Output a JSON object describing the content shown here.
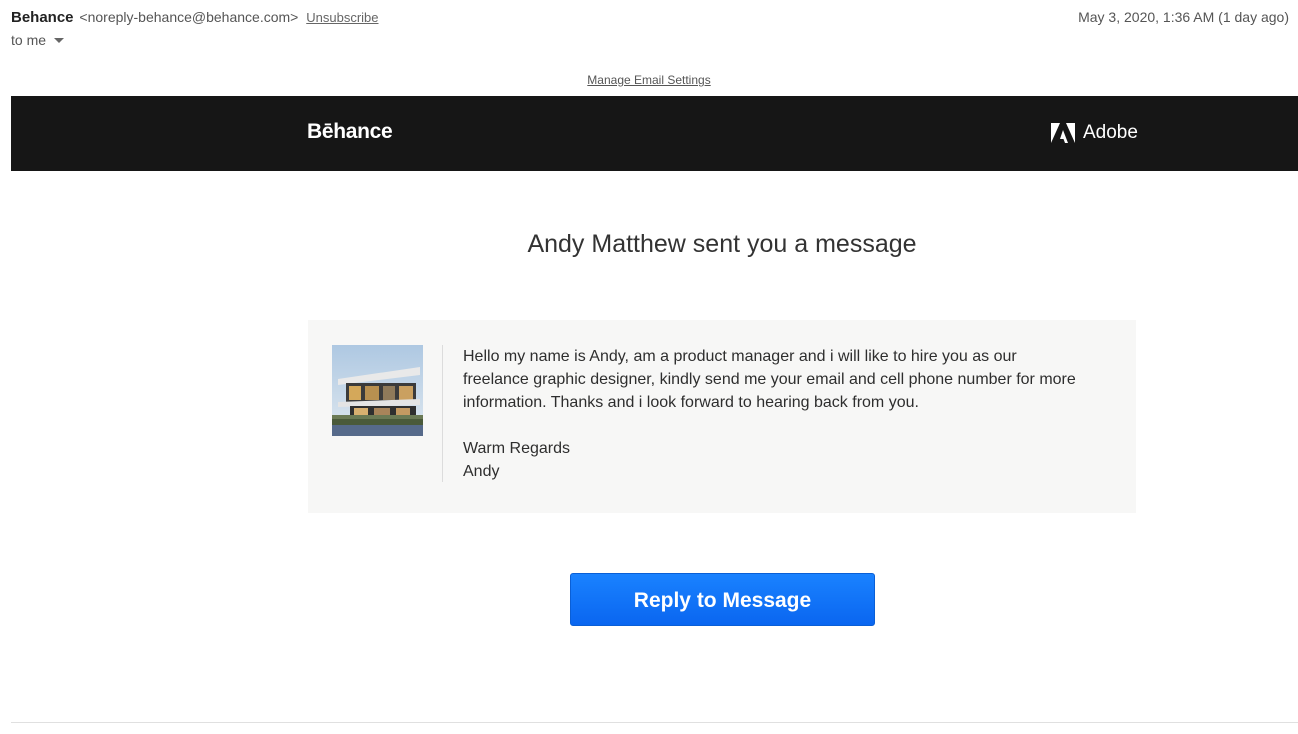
{
  "header": {
    "sender_name": "Behance",
    "sender_email": "<noreply-behance@behance.com>",
    "unsubscribe_label": "Unsubscribe",
    "date": "May 3, 2020, 1:36 AM (1 day ago)",
    "to_label": "to me"
  },
  "manage_settings_label": "Manage Email Settings",
  "brand_bar": {
    "behance_label": "Bēhance",
    "adobe_label": "Adobe"
  },
  "message": {
    "title": "Andy Matthew sent you a message",
    "paragraph": "Hello my name is Andy, am a product manager and i will like to hire you as our freelance graphic designer, kindly send me your email and cell phone number for more information. Thanks and i look forward to hearing back from you.",
    "regards": "Warm Regards",
    "signature": "Andy"
  },
  "reply_button_label": "Reply to Message",
  "colors": {
    "brand_bar": "#161616",
    "button": "#0a66f0",
    "card_background": "#f7f7f6"
  }
}
